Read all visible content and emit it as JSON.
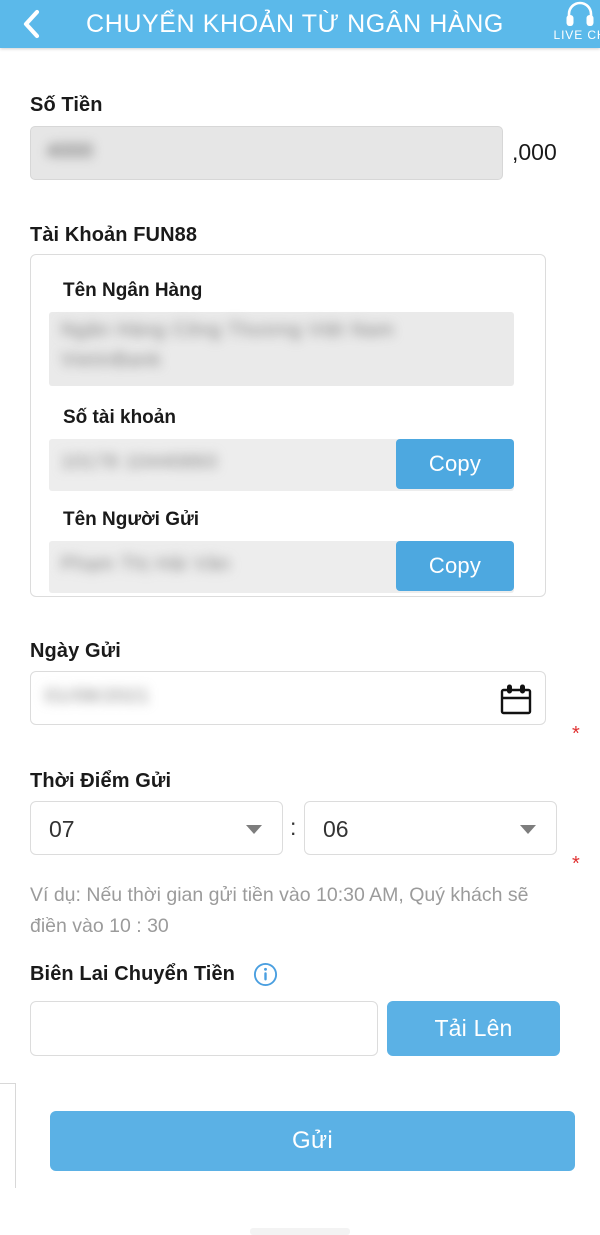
{
  "header": {
    "back_icon": "chevron-left-icon",
    "title": "CHUYỂN KHOẢN TỪ NGÂN HÀNG",
    "live_chat_label": "LIVE CH",
    "live_chat_icon": "headset-icon",
    "background_color": "#5BB9EA"
  },
  "amount": {
    "label": "Số Tiền",
    "value": "4000",
    "suffix": ",000"
  },
  "account": {
    "label": "Tài Khoản FUN88",
    "bank_name": {
      "label": "Tên Ngân Hàng",
      "line1": "Ngân Hàng Công Thương Việt Nam",
      "line2": "VietinBank"
    },
    "account_number": {
      "label": "Số tài khoản",
      "value": "10178 10440893",
      "copy_label": "Copy"
    },
    "sender_name": {
      "label": "Tên Người Gửi",
      "value": "Phạm Thị Hải Vân",
      "copy_label": "Copy"
    }
  },
  "date": {
    "label": "Ngày Gửi",
    "value": "01/08/2021",
    "calendar_icon": "calendar-icon",
    "required_marker": "*"
  },
  "time": {
    "label": "Thời Điểm Gửi",
    "hour": "07",
    "minute": "06",
    "separator": ":",
    "caret_icon": "chevron-down-icon",
    "required_marker": "*",
    "hint": "Ví dụ: Nếu thời gian gửi tiền vào 10:30 AM, Quý khách sẽ điền vào 10 : 30"
  },
  "receipt": {
    "label": "Biên Lai Chuyển Tiền",
    "info_icon": "info-circle-icon",
    "file_value": "",
    "upload_label": "Tải Lên"
  },
  "submit": {
    "label": "Gửi"
  },
  "colors": {
    "header_blue": "#5BB9EA",
    "button_blue": "#4DA8E0",
    "upload_blue": "#5BB1E5",
    "required_red": "#e03030",
    "info_blue": "#4a9fe0"
  }
}
